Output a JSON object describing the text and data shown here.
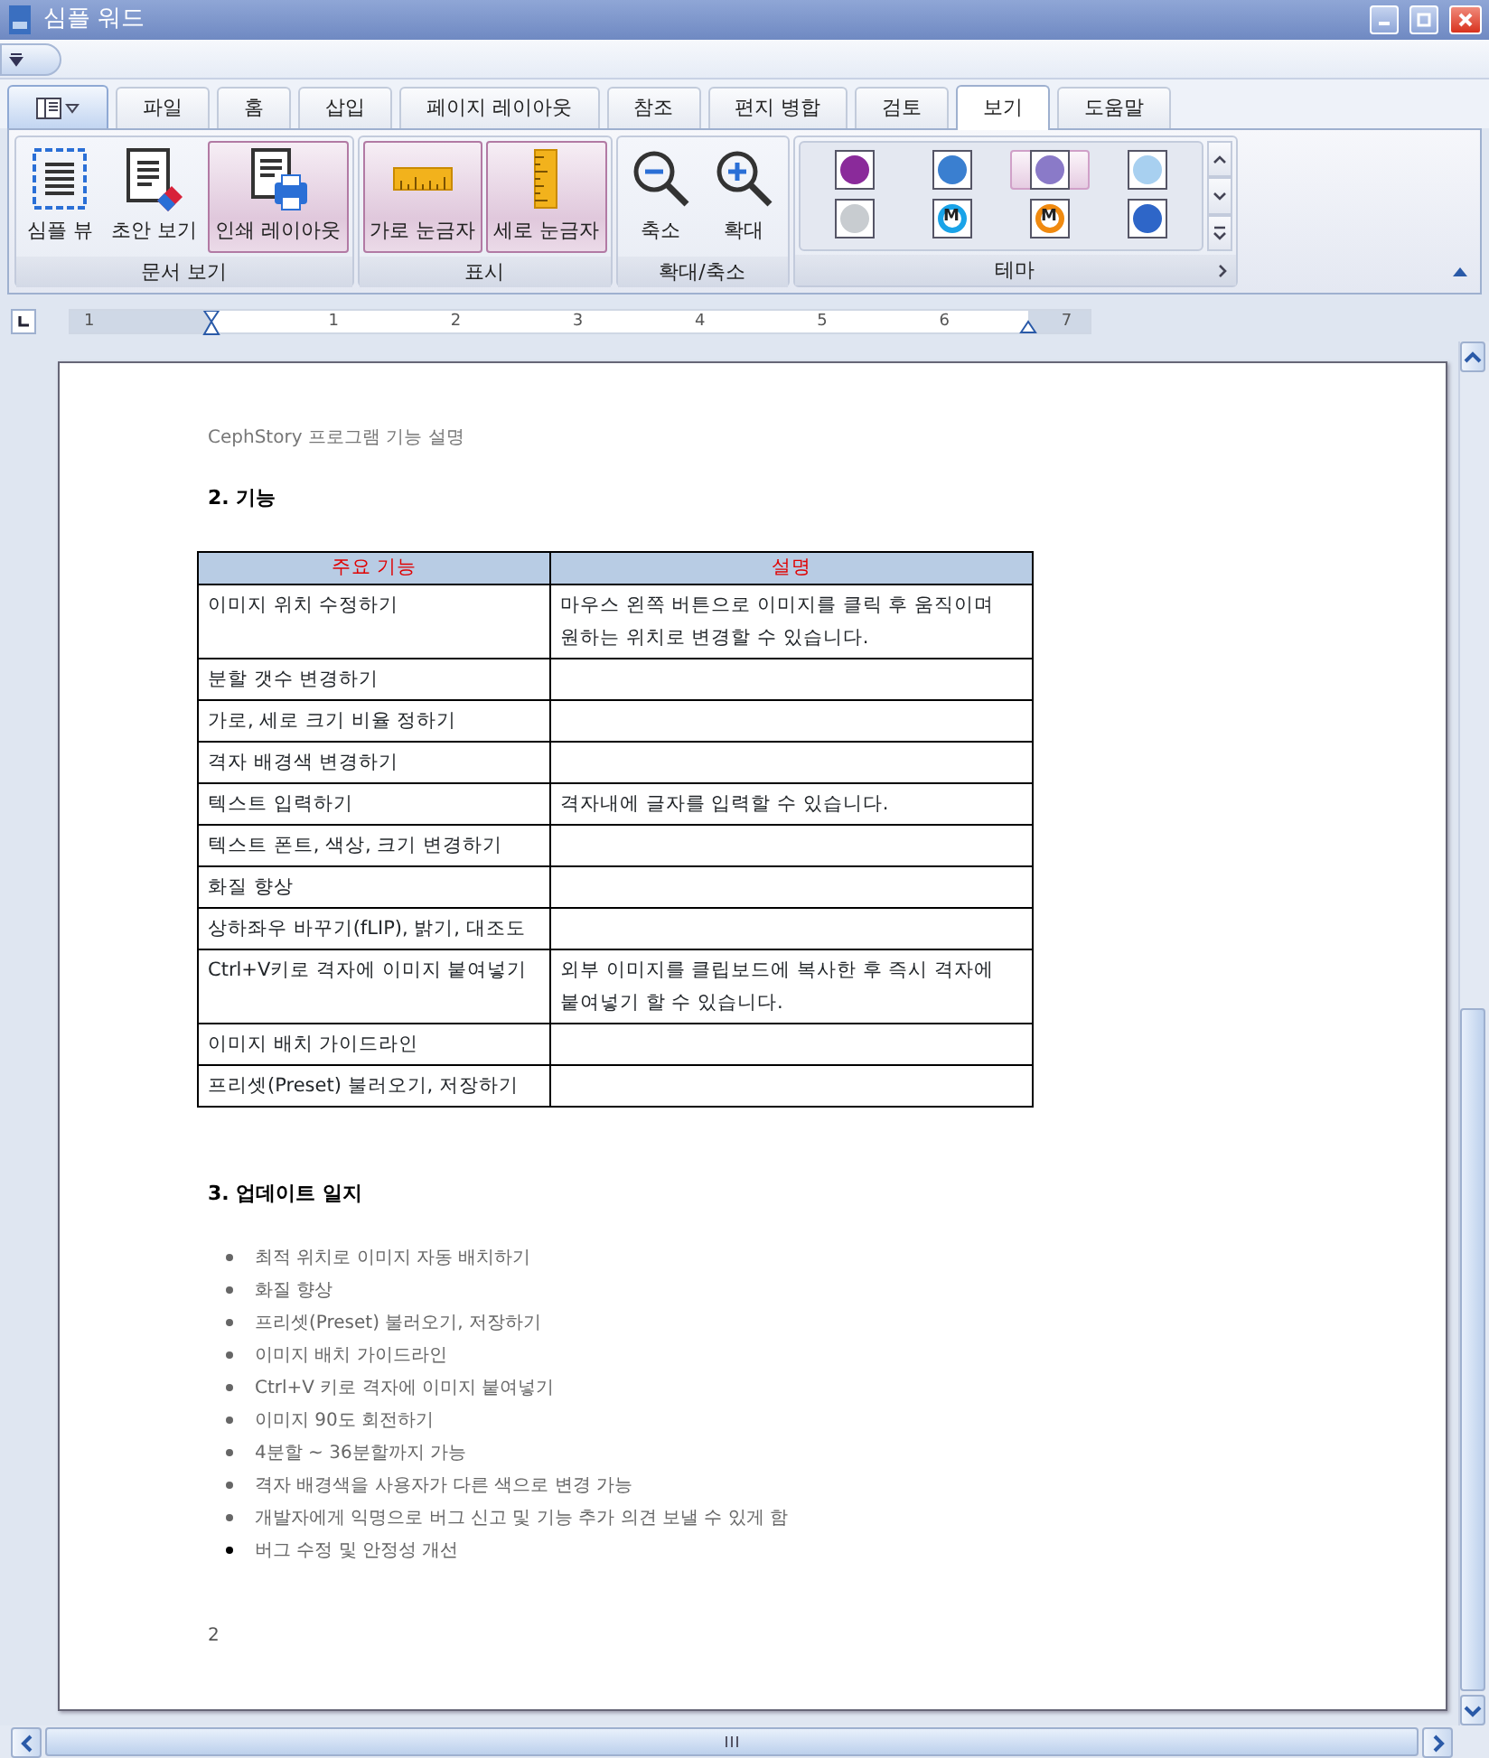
{
  "window": {
    "title": "심플 워드"
  },
  "tabs": [
    {
      "label": "파일",
      "selected": false
    },
    {
      "label": "홈",
      "selected": false
    },
    {
      "label": "삽입",
      "selected": false
    },
    {
      "label": "페이지 레이아웃",
      "selected": false
    },
    {
      "label": "참조",
      "selected": false
    },
    {
      "label": "편지 병합",
      "selected": false
    },
    {
      "label": "검토",
      "selected": false
    },
    {
      "label": "보기",
      "selected": true
    },
    {
      "label": "도움말",
      "selected": false
    }
  ],
  "ribbon": {
    "groups": [
      {
        "label": "문서 보기",
        "buttons": [
          {
            "kind": "simple",
            "label": "심플 뷰",
            "selected": false
          },
          {
            "kind": "draft",
            "label": "초안 보기",
            "selected": false
          },
          {
            "kind": "print",
            "label": "인쇄 레이아웃",
            "selected": true
          }
        ]
      },
      {
        "label": "표시",
        "buttons": [
          {
            "kind": "hruler",
            "label": "가로 눈금자",
            "selected": true
          },
          {
            "kind": "vruler",
            "label": "세로 눈금자",
            "selected": true
          }
        ]
      },
      {
        "label": "확대/축소",
        "buttons": [
          {
            "kind": "zoomout",
            "label": "축소",
            "selected": false
          },
          {
            "kind": "zoomin",
            "label": "확대",
            "selected": false
          }
        ]
      }
    ],
    "themes": {
      "label": "테마",
      "items": [
        {
          "color": "#8a2a9a",
          "selected": false
        },
        {
          "color": "#3a7fd0",
          "selected": false
        },
        {
          "color": "#8a7ac8",
          "selected": true
        },
        {
          "color": "#a8d0f0",
          "selected": false
        },
        {
          "color": "#c8ccd0",
          "selected": false
        },
        {
          "color": "#19a3e8",
          "label": "M",
          "selected": false
        },
        {
          "color": "#f08a10",
          "label": "M",
          "selected": false
        },
        {
          "color": "#2e66c8",
          "selected": false
        }
      ]
    }
  },
  "ruler": {
    "labels": [
      "1",
      "1",
      "2",
      "3",
      "4",
      "5",
      "6",
      "7"
    ]
  },
  "document": {
    "header": "CephStory 프로그램 기능 설명",
    "section_1": {
      "heading": "2. 기능",
      "table": {
        "columns": [
          "주요 기능",
          "설명"
        ],
        "rows": [
          [
            "이미지 위치 수정하기",
            "마우스 왼쪽 버튼으로 이미지를 클릭 후 움직이며 원하는 위치로 변경할 수 있습니다."
          ],
          [
            "분할 갯수 변경하기",
            ""
          ],
          [
            "가로, 세로 크기 비율 정하기",
            ""
          ],
          [
            "격자 배경색 변경하기",
            ""
          ],
          [
            "텍스트 입력하기",
            "격자내에 글자를 입력할 수 있습니다."
          ],
          [
            "텍스트 폰트, 색상, 크기 변경하기",
            ""
          ],
          [
            "화질 향상",
            ""
          ],
          [
            "상하좌우 바꾸기(fLIP), 밝기, 대조도",
            ""
          ],
          [
            "Ctrl+V키로 격자에 이미지 붙여넣기",
            "외부 이미지를 클립보드에 복사한 후 즉시 격자에 붙여넣기 할 수 있습니다."
          ],
          [
            "이미지 배치 가이드라인",
            ""
          ],
          [
            "프리셋(Preset) 불러오기, 저장하기",
            ""
          ]
        ]
      }
    },
    "section_2": {
      "heading": "3. 업데이트 일지",
      "items": [
        "최적 위치로 이미지 자동 배치하기",
        "화질 향상",
        "프리셋(Preset) 불러오기, 저장하기",
        "이미지 배치 가이드라인",
        "Ctrl+V 키로 격자에 이미지 붙여넣기",
        "이미지 90도 회전하기",
        "4분할 ~ 36분할까지 가능",
        "격자 배경색을 사용자가 다른 색으로 변경 가능",
        "개발자에게 익명으로 버그 신고 및 기능 추가 의견 보낼 수 있게 함",
        "버그 수정 및 안정성 개선"
      ]
    },
    "page_number": "2"
  }
}
